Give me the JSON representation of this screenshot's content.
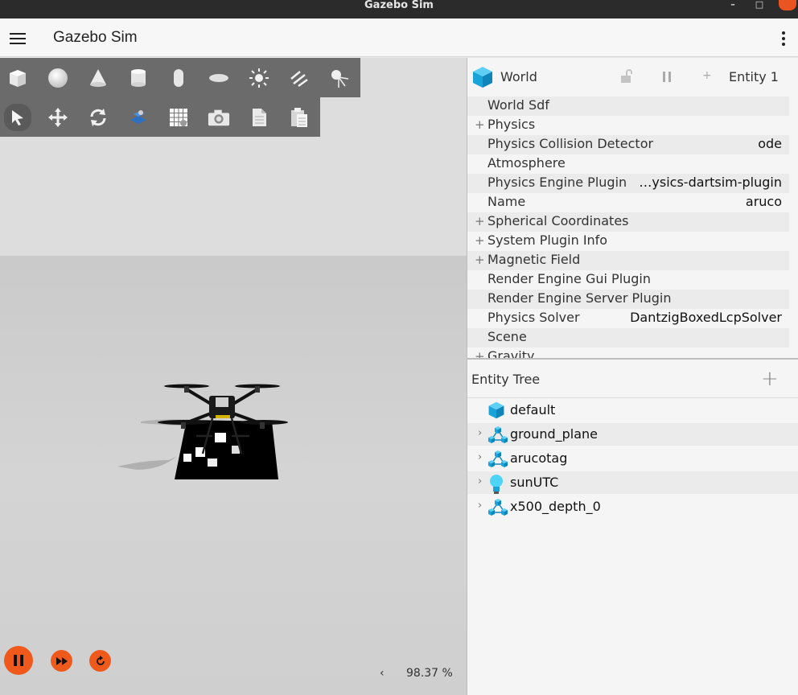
{
  "window": {
    "title": "Gazebo Sim",
    "minimize": "–",
    "maximize": "□"
  },
  "header": {
    "app_name": "Gazebo Sim"
  },
  "toolbar_shapes": [
    "box",
    "sphere",
    "cone",
    "cylinder",
    "capsule",
    "ellipsoid",
    "light",
    "directional-light",
    "spot-light"
  ],
  "toolbar_transform": [
    "select",
    "translate",
    "rotate",
    "snap",
    "grid",
    "screenshot",
    "copy",
    "paste"
  ],
  "playback": {
    "real_time_factor": "98.37 %",
    "collapse_arrow": "‹"
  },
  "component_inspector": {
    "title": "World",
    "entity": "Entity 1",
    "properties": [
      {
        "label": "World Sdf",
        "value": "",
        "expandable": false
      },
      {
        "label": "Physics",
        "value": "",
        "expandable": true
      },
      {
        "label": "Physics Collision Detector",
        "value": "ode",
        "expandable": false
      },
      {
        "label": "Atmosphere",
        "value": "",
        "expandable": false
      },
      {
        "label": "Physics Engine Plugin",
        "value": "…ysics-dartsim-plugin",
        "expandable": false
      },
      {
        "label": "Name",
        "value": "aruco",
        "expandable": false
      },
      {
        "label": "Spherical Coordinates",
        "value": "",
        "expandable": true
      },
      {
        "label": "System Plugin Info",
        "value": "",
        "expandable": true
      },
      {
        "label": "Magnetic Field",
        "value": "",
        "expandable": true
      },
      {
        "label": "Render Engine Gui Plugin",
        "value": "",
        "expandable": false
      },
      {
        "label": "Render Engine Server Plugin",
        "value": "",
        "expandable": false
      },
      {
        "label": "Physics Solver",
        "value": "DantzigBoxedLcpSolver",
        "expandable": false
      },
      {
        "label": "Scene",
        "value": "",
        "expandable": false
      },
      {
        "label": "Gravity",
        "value": "",
        "expandable": true
      }
    ]
  },
  "entity_tree": {
    "title": "Entity Tree",
    "add": "+",
    "items": [
      {
        "label": "default",
        "icon": "world-icon",
        "expandable": false
      },
      {
        "label": "ground_plane",
        "icon": "model-icon",
        "expandable": true
      },
      {
        "label": "arucotag",
        "icon": "model-icon",
        "expandable": true
      },
      {
        "label": "sunUTC",
        "icon": "light-icon",
        "expandable": true
      },
      {
        "label": "x500_depth_0",
        "icon": "model-icon",
        "expandable": true
      }
    ]
  },
  "colors": {
    "accent": "#ef5a1c",
    "toolbar": "#6b6b6b",
    "entity_blue": "#1aa3d9"
  }
}
